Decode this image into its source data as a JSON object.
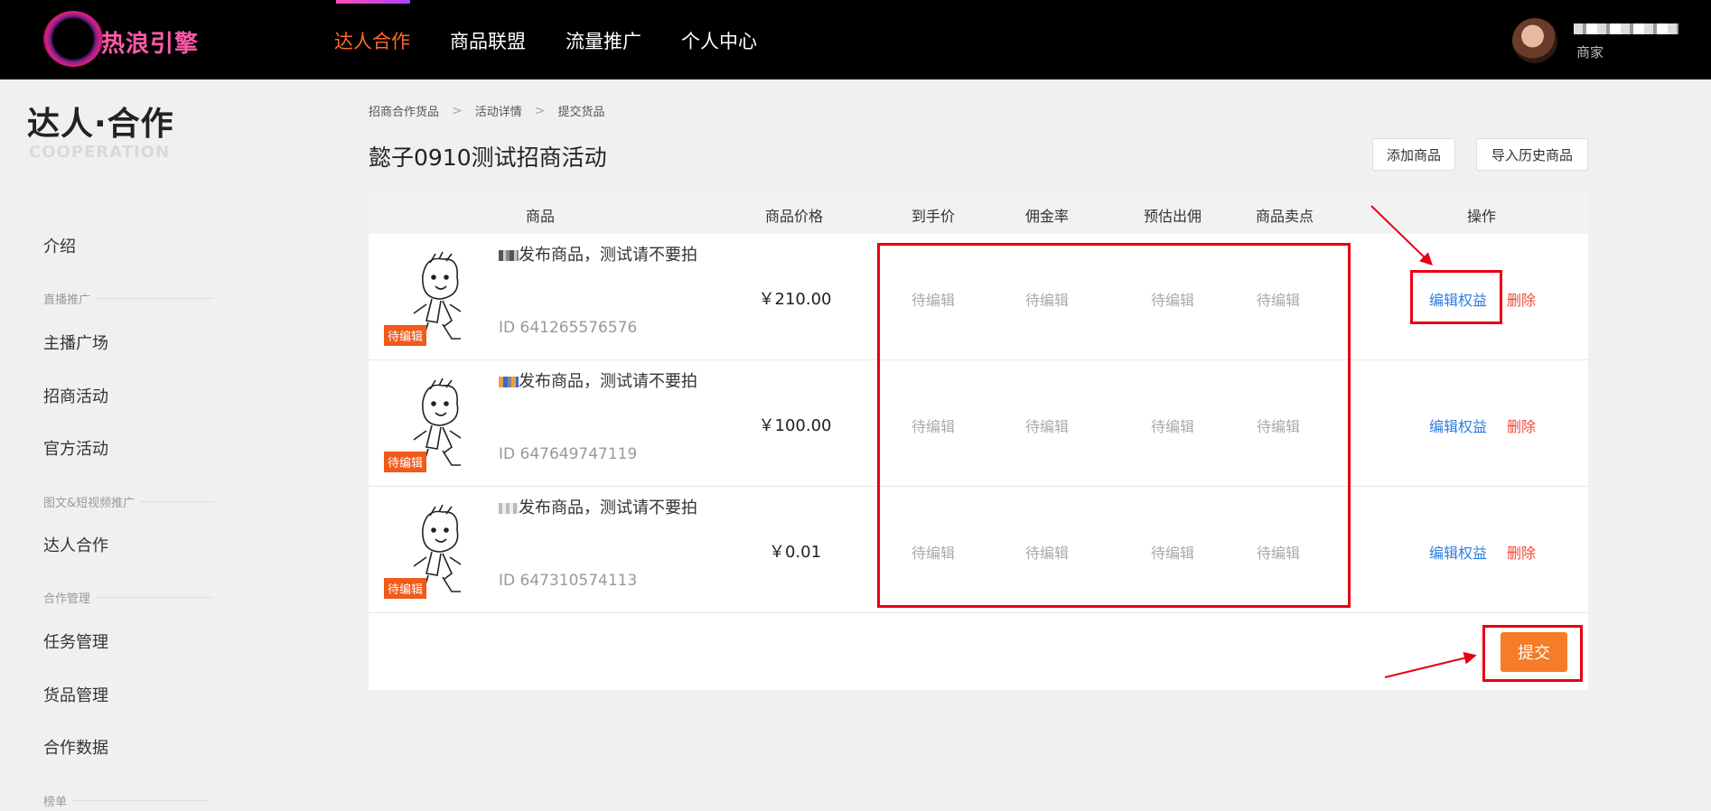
{
  "brand": {
    "logo_text": "热浪引擎"
  },
  "nav": {
    "items": [
      "达人合作",
      "商品联盟",
      "流量推广",
      "个人中心"
    ],
    "active_index": 0
  },
  "user": {
    "role": "商家"
  },
  "sidebar": {
    "title_cn": "达人·合作",
    "title_en": "COOPERATION",
    "intro": "介绍",
    "group_live": "直播推广",
    "anchor_square": "主播广场",
    "merchant_activity": "招商活动",
    "official_activity": "官方活动",
    "group_media": "图文&短视频推广",
    "talent_coop": "达人合作",
    "group_coop": "合作管理",
    "task_mgmt": "任务管理",
    "goods_mgmt": "货品管理",
    "coop_data": "合作数据",
    "group_rank": "榜单"
  },
  "breadcrumb": [
    "招商合作货品",
    "活动详情",
    "提交货品"
  ],
  "page_title": "懿子0910测试招商活动",
  "toolbar": {
    "add_goods": "添加商品",
    "import_history": "导入历史商品"
  },
  "table": {
    "columns": [
      "商品",
      "商品价格",
      "到手价",
      "佣金率",
      "预估出佣",
      "商品卖点",
      "操作"
    ],
    "pending_tag": "待编辑",
    "pending_text": "待编辑",
    "edit_rights": "编辑权益",
    "delete": "删除",
    "rows": [
      {
        "name_suffix": "发布商品，测试请不要拍",
        "id": "ID 641265576576",
        "price": "￥210.00"
      },
      {
        "name_suffix": "发布商品，测试请不要拍",
        "id": "ID 647649747119",
        "price": "￥100.00"
      },
      {
        "name_suffix": "发布商品，测试请不要拍",
        "id": "ID 647310574113",
        "price": "￥0.01"
      }
    ]
  },
  "submit_label": "提交",
  "colors": {
    "accent_orange": "#f57c28",
    "nav_active": "#ff6a2a",
    "link_blue": "#2b7de0",
    "link_red": "#f04a3a",
    "annotation_red": "#e60012"
  }
}
